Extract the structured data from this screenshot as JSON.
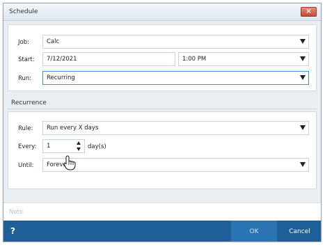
{
  "window": {
    "title": "Schedule",
    "close_icon": "close-x-icon"
  },
  "job": {
    "label": "Job:",
    "value": "Calc"
  },
  "start": {
    "label": "Start:",
    "date": "7/12/2021",
    "time": "1:00 PM"
  },
  "run": {
    "label": "Run:",
    "value": "Recurring"
  },
  "recurrence": {
    "section_title": "Recurrence",
    "rule_label": "Rule:",
    "rule_value": "Run every X days",
    "every_label": "Every:",
    "every_value": "1",
    "every_unit": "day(s)",
    "until_label": "Until:",
    "until_value": "Foreve"
  },
  "note": {
    "placeholder": "Note"
  },
  "footer": {
    "help": "?",
    "ok": "OK",
    "cancel": "Cancel"
  },
  "colors": {
    "accent": "#1f5f99",
    "focus": "#3a8fd8"
  }
}
